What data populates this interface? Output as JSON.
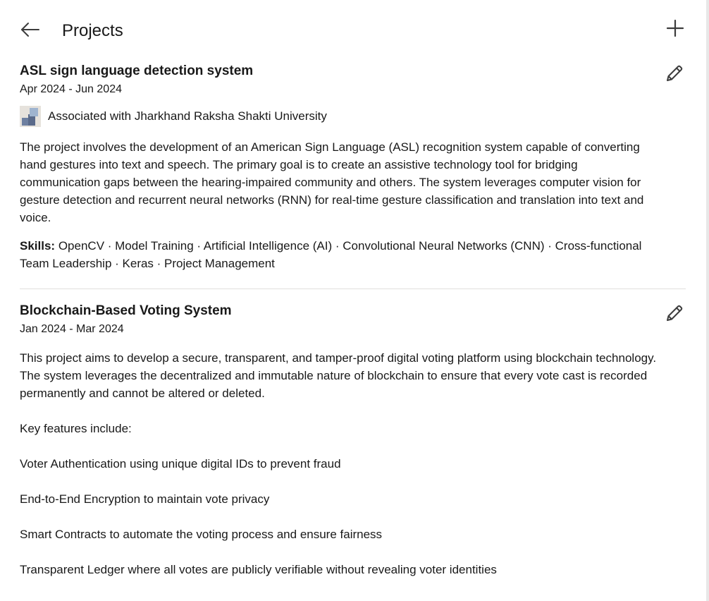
{
  "header": {
    "title": "Projects"
  },
  "projects": [
    {
      "title": "ASL sign language detection system",
      "dates": "Apr 2024 - Jun 2024",
      "associated": "Associated with Jharkhand Raksha Shakti University",
      "description": [
        "The project involves the development of an American Sign Language (ASL) recognition system capable of converting hand gestures into text and speech. The primary goal is to create an assistive technology tool for bridging communication gaps between the hearing-impaired community and others. The system leverages computer vision for gesture detection and recurrent neural networks (RNN) for real-time gesture classification and translation into text and voice."
      ],
      "skills_label": "Skills:",
      "skills": "OpenCV · Model Training · Artificial Intelligence (AI) · Convolutional Neural Networks (CNN) · Cross-functional Team Leadership · Keras · Project Management"
    },
    {
      "title": "Blockchain-Based Voting System",
      "dates": "Jan 2024 - Mar 2024",
      "description": [
        "This project aims to develop a secure, transparent, and tamper-proof digital voting platform using blockchain technology. The system leverages the decentralized and immutable nature of blockchain to ensure that every vote cast is recorded permanently and cannot be altered or deleted.",
        "Key features include:",
        "Voter Authentication using unique digital IDs to prevent fraud",
        "End-to-End Encryption to maintain vote privacy",
        "Smart Contracts to automate the voting process and ensure fairness",
        "Transparent Ledger where all votes are publicly verifiable without revealing voter identities"
      ]
    }
  ],
  "icons": {
    "back": "arrow-left-icon",
    "add": "plus-icon",
    "edit": "pencil-icon"
  }
}
